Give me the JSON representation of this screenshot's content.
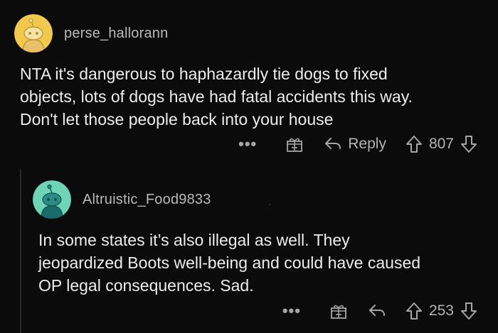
{
  "comments": [
    {
      "username": "perse_hallorann",
      "avatar_color": "#f2c94c",
      "avatar_body_color": "#e8c06a",
      "text": "NTA it's dangerous to haphazardly tie dogs to fixed\nobjects, lots of dogs have had fatal accidents this way.\nDon't let those people back into your house",
      "actions": {
        "more": "•••",
        "reply_label": "Reply",
        "score": "807"
      }
    },
    {
      "username": "Altruistic_Food9833",
      "avatar_color": "#6fd3b5",
      "avatar_body_color": "#1b6b6b",
      "text": "In some states it’s also illegal as well. They\njeopardized Boots well-being and could have caused\nOP legal consequences. Sad.",
      "actions": {
        "more": "•••",
        "score": "253"
      }
    }
  ],
  "icons": {
    "more": "more-options-icon",
    "gift": "gift-award-icon",
    "reply": "reply-arrow-icon",
    "upvote": "upvote-arrow-icon",
    "downvote": "downvote-arrow-icon"
  }
}
